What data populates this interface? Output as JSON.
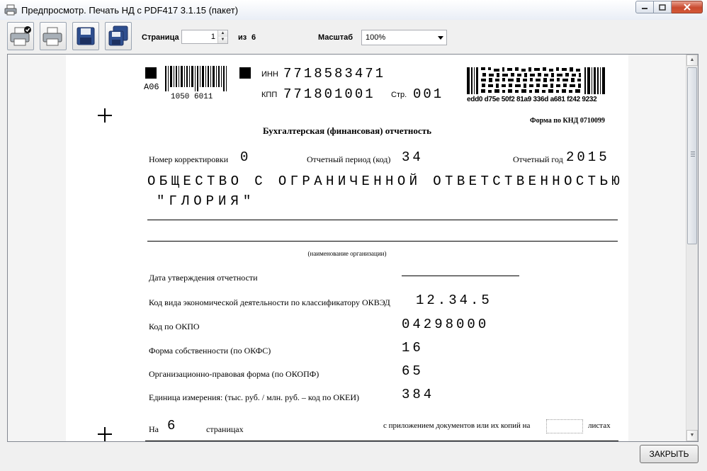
{
  "window": {
    "title": "Предпросмотр. Печать НД с PDF417 3.1.15 (пакет)"
  },
  "toolbar": {
    "page_label": "Страница",
    "page_value": "1",
    "of_label": "из",
    "total_pages": "6",
    "zoom_label": "Масштаб",
    "zoom_value": "100%"
  },
  "document": {
    "barcode_code": "A06",
    "barcode_number": "1050 6011",
    "inn_label": "ИНН",
    "inn_value": "7718583471",
    "kpp_label": "КПП",
    "kpp_value": "771801001",
    "page_label": "Стр.",
    "page_value": "001",
    "pdf417_caption": "edd0 d75e 50f2 81a9 336d a681 f242 9232",
    "form_code": "Форма по КНД 0710099",
    "title": "Бухгалтерская (финансовая) отчетность",
    "correction_label": "Номер корректировки",
    "correction_value": "0",
    "period_label": "Отчетный период (код)",
    "period_value": "34",
    "year_label": "Отчетный год",
    "year_value": "2015",
    "org_name_line1": "ОБЩЕСТВО С ОГРАНИЧЕННОЙ ОТВЕТСТВЕННОСТЬЮ",
    "org_name_line2": "\"ГЛОРИЯ\"",
    "org_name_caption": "(наименование организации)",
    "fields": [
      {
        "label": "Дата утверждения отчетности",
        "value": ""
      },
      {
        "label": "Код вида экономической деятельности по классификатору ОКВЭД",
        "value": "12.34.5"
      },
      {
        "label": "Код по ОКПО",
        "value": "04298000"
      },
      {
        "label": "Форма собственности (по ОКФС)",
        "value": "16"
      },
      {
        "label": "Организационно-правовая форма (по ОКОПФ)",
        "value": "65"
      },
      {
        "label": "Единица измерения: (тыс. руб. / млн. руб. – код по ОКЕИ)",
        "value": "384"
      }
    ],
    "pages_prefix": "На",
    "pages_value": "6",
    "pages_suffix": "страницах",
    "attach_prefix": "с приложением документов или их копий на",
    "attach_suffix": "листах"
  },
  "footer": {
    "close_label": "ЗАКРЫТЬ"
  }
}
